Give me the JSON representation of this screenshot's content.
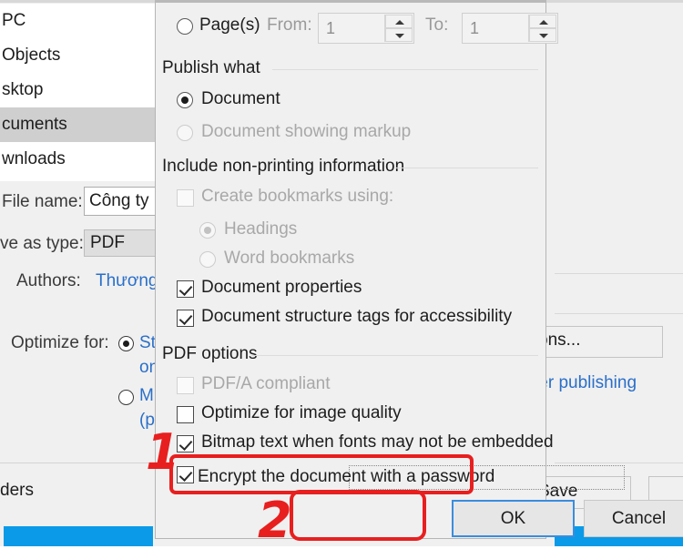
{
  "background": {
    "nav_items": [
      {
        "label": "PC"
      },
      {
        "label": "Objects"
      },
      {
        "label": "sktop"
      },
      {
        "label": "cuments"
      },
      {
        "label": "wnloads"
      }
    ],
    "file_name_label": "File name:",
    "file_name_value": "Công ty",
    "save_as_type_label": "ve as type:",
    "save_as_type_value": "PDF",
    "authors_label": "Authors:",
    "authors_value": "Thương",
    "optimize_label": "Optimize for:",
    "optimize_standard_line1": "St",
    "optimize_standard_line2": "on",
    "optimize_minimum_line1": "M",
    "optimize_minimum_line2": "(p",
    "folders_label": "ders",
    "options_button": "ons...",
    "publishing_link": "ter publishing",
    "save_button": "Save"
  },
  "dialog": {
    "pages_radio_label": "Page(s)",
    "from_label": "From:",
    "from_value": "1",
    "to_label": "To:",
    "to_value": "1",
    "publish_what": {
      "header": "Publish what",
      "document_label": "Document",
      "document_markup_label": "Document showing markup"
    },
    "include_non_printing": {
      "header": "Include non-printing information",
      "create_bookmarks_label": "Create bookmarks using:",
      "headings_label": "Headings",
      "word_bookmarks_label": "Word bookmarks",
      "document_properties_label": "Document properties",
      "document_structure_label": "Document structure tags for accessibility"
    },
    "pdf_options": {
      "header": "PDF options",
      "pdfa_label": "PDF/A compliant",
      "optimize_image_label": "Optimize for image quality",
      "bitmap_text_label": "Bitmap text when fonts may not be embedded",
      "encrypt_label": "Encrypt the document with a password"
    },
    "ok_button": "OK",
    "cancel_button": "Cancel"
  },
  "annotations": {
    "step_one": "1",
    "step_two": "2",
    "color": "#e81f1f"
  }
}
